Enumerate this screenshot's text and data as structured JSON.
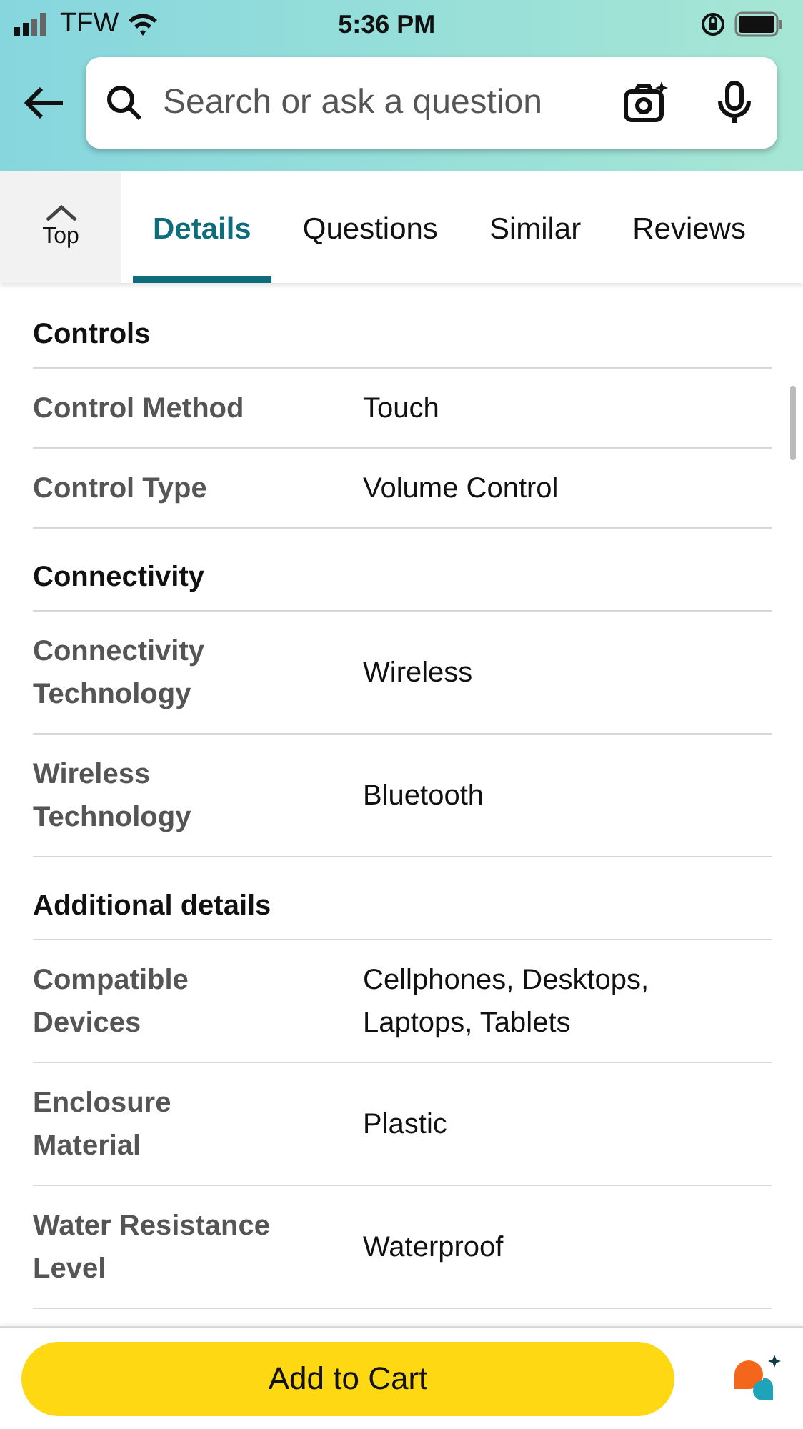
{
  "status_bar": {
    "carrier": "TFW",
    "time": "5:36 PM"
  },
  "search": {
    "placeholder": "Search or ask a question"
  },
  "top_button": {
    "label": "Top"
  },
  "tabs": [
    {
      "label": "Details",
      "selected": true
    },
    {
      "label": "Questions",
      "selected": false
    },
    {
      "label": "Similar",
      "selected": false
    },
    {
      "label": "Reviews",
      "selected": false
    }
  ],
  "sections": [
    {
      "title": "Controls",
      "rows": [
        {
          "label": "Control Method",
          "value": "Touch"
        },
        {
          "label": "Control Type",
          "value": "Volume Control"
        }
      ]
    },
    {
      "title": "Connectivity",
      "rows": [
        {
          "label": "Connectivity Technology",
          "value": "Wireless"
        },
        {
          "label": "Wireless Technology",
          "value": "Bluetooth"
        }
      ]
    },
    {
      "title": "Additional details",
      "rows": [
        {
          "label": "Compatible Devices",
          "value": "Cellphones, Desktops, Laptops, Tablets"
        },
        {
          "label": "Enclosure Material",
          "value": "Plastic"
        },
        {
          "label": "Water Resistance Level",
          "value": "Waterproof"
        }
      ]
    }
  ],
  "cart_button": {
    "label": "Add to Cart"
  }
}
